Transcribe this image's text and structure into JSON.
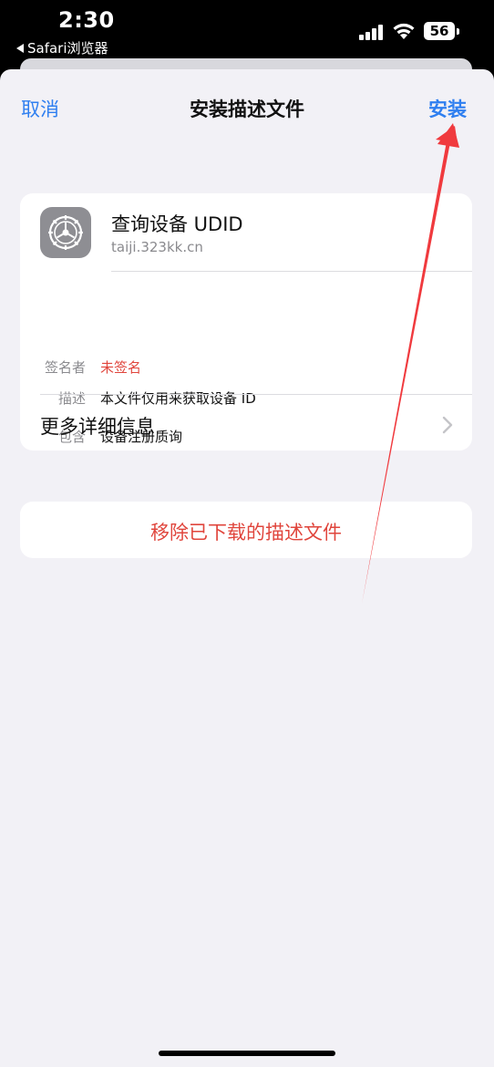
{
  "status_bar": {
    "time": "2:30",
    "back_app": "Safari浏览器",
    "battery": "56",
    "icons": [
      "signal-icon",
      "wifi-icon",
      "battery-icon"
    ]
  },
  "nav": {
    "cancel": "取消",
    "title": "安装描述文件",
    "install": "安装"
  },
  "profile": {
    "name": "查询设备 UDID",
    "domain": "taiji.323kk.cn",
    "icon": "settings-gear-icon",
    "rows": [
      {
        "label": "签名者",
        "value": "未签名"
      },
      {
        "label": "描述",
        "value": "本文件仅用来获取设备 ID"
      },
      {
        "label": "包含",
        "value": "设备注册质询"
      }
    ],
    "more_info": "更多详细信息"
  },
  "remove": {
    "label": "移除已下载的描述文件"
  },
  "colors": {
    "accent": "#2f7ff0",
    "destructive": "#e0453c",
    "background": "#f2f1f6",
    "annotation_arrow": "#f03a3e"
  }
}
